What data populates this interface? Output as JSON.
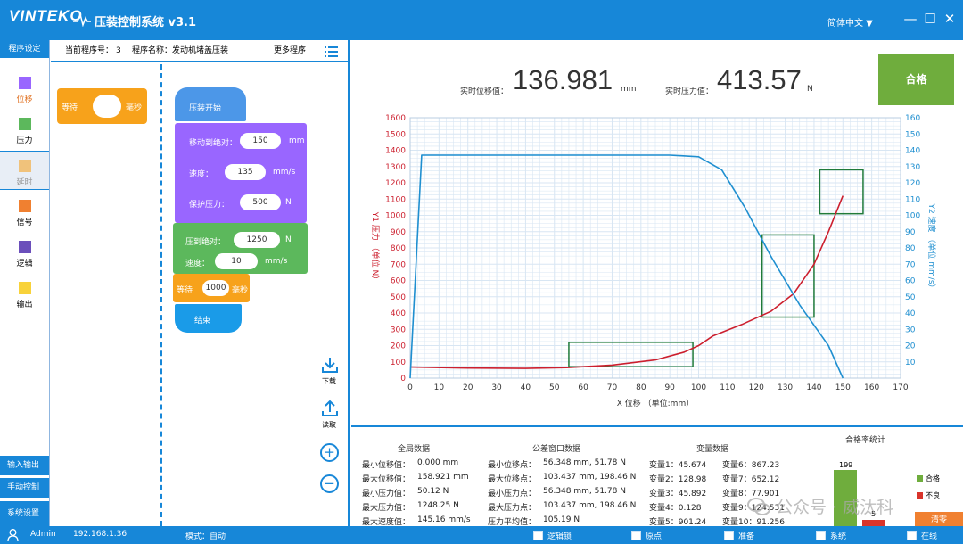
{
  "app": {
    "logo": "VINTEKO",
    "title": "压装控制系统 v3.1",
    "language": "简体中文 ▼",
    "minimize": "—",
    "maximize": "☐",
    "close": "✕"
  },
  "sidebar": {
    "header": "程序设定",
    "categories": [
      {
        "label": "位移",
        "color": "#9966ff"
      },
      {
        "label": "压力",
        "color": "#5cb85c"
      },
      {
        "label": "延时",
        "color": "#f0c27b"
      },
      {
        "label": "信号",
        "color": "#f08030"
      },
      {
        "label": "逻辑",
        "color": "#6b4fbb"
      },
      {
        "label": "输出",
        "color": "#f8d23a"
      }
    ],
    "bottom": [
      "输入输出",
      "手动控制",
      "系统设置"
    ]
  },
  "program": {
    "number_label": "当前程序号：",
    "number": "3",
    "name_label": "程序名称：",
    "name": "发动机堵盖压装",
    "more": "更多程序",
    "palette": {
      "wait_label": "等待",
      "wait_unit": "毫秒"
    },
    "script": {
      "start": "压装开始",
      "move_label": "移动到绝对：",
      "move_value": "150",
      "move_unit": "mm",
      "speed_label": "速度：",
      "speed_value": "135",
      "speed_unit": "mm/s",
      "protect_label": "保护压力：",
      "protect_value": "500",
      "protect_unit": "N",
      "press_label": "压到绝对：",
      "press_value": "1250",
      "press_unit": "N",
      "speed2_label": "速度：",
      "speed2_value": "10",
      "speed2_unit": "mm/s",
      "wait_label": "等待",
      "wait_value": "1000",
      "wait_unit": "毫秒",
      "end": "结束"
    },
    "tools": {
      "download": "下载",
      "read": "读取",
      "zoom_in": "+",
      "zoom_out": "−"
    }
  },
  "realtime": {
    "disp_label": "实时位移值：",
    "disp_value": "136.981",
    "disp_unit": "mm",
    "force_label": "实时压力值：",
    "force_value": "413.57",
    "force_unit": "N",
    "result": "合格"
  },
  "chart_data": {
    "type": "line",
    "title": "",
    "xlabel": "X 位移 （单位:mm）",
    "ylabel": "Y1 压力 （单位 N）",
    "y2label": "Y2 速度 （单位 mm/s）",
    "xlim": [
      0,
      170
    ],
    "ylim": [
      0,
      1600
    ],
    "y2lim": [
      0,
      160
    ],
    "grid": true,
    "xticks": [
      0,
      10,
      20,
      30,
      40,
      50,
      60,
      70,
      80,
      90,
      100,
      110,
      120,
      130,
      140,
      150,
      160,
      170
    ],
    "yticks": [
      0,
      100,
      200,
      300,
      400,
      500,
      600,
      700,
      800,
      900,
      1000,
      1100,
      1200,
      1300,
      1400,
      1500,
      1600
    ],
    "y2ticks": [
      10,
      20,
      30,
      40,
      50,
      60,
      70,
      80,
      90,
      100,
      110,
      120,
      130,
      140,
      150,
      160
    ],
    "series": [
      {
        "axis": "y1",
        "color": "#cc1f2e",
        "x": [
          0,
          20,
          40,
          55,
          70,
          85,
          95,
          100,
          105,
          115,
          125,
          133,
          140,
          145,
          150
        ],
        "y": [
          68,
          62,
          60,
          65,
          80,
          112,
          160,
          200,
          260,
          330,
          410,
          520,
          700,
          900,
          1120
        ]
      },
      {
        "axis": "y2",
        "color": "#1f8fd0",
        "x": [
          0,
          4,
          8,
          50,
          90,
          100,
          108,
          116,
          125,
          135,
          145,
          150
        ],
        "y": [
          0,
          137,
          137,
          137,
          137,
          136,
          128,
          105,
          75,
          45,
          20,
          0
        ]
      }
    ],
    "windows": [
      {
        "x": [
          55,
          98
        ],
        "y": [
          70,
          220
        ]
      },
      {
        "x": [
          122,
          140
        ],
        "y": [
          375,
          880
        ]
      },
      {
        "x": [
          142,
          157
        ],
        "y": [
          1010,
          1280
        ]
      }
    ]
  },
  "stats": {
    "global_title": "全局数据",
    "global": [
      {
        "label": "最小位移值：",
        "value": "0.000 mm"
      },
      {
        "label": "最大位移值：",
        "value": "158.921 mm"
      },
      {
        "label": "最小压力值：",
        "value": "50.12 N"
      },
      {
        "label": "最大压力值：",
        "value": "1248.25 N"
      },
      {
        "label": "最大速度值：",
        "value": "145.16 mm/s"
      }
    ],
    "window_title": "公差窗口数据",
    "window": [
      {
        "label": "最小位移点：",
        "value": "56.348 mm, 51.78 N"
      },
      {
        "label": "最大位移点：",
        "value": "103.437 mm, 198.46 N"
      },
      {
        "label": "最小压力点：",
        "value": "56.348 mm, 51.78 N"
      },
      {
        "label": "最大压力点：",
        "value": "103.437 mm, 198.46 N"
      },
      {
        "label": "压力平均值：",
        "value": "105.19 N"
      }
    ],
    "vars_title": "变量数据",
    "vars_left": [
      "变量1：45.674",
      "变量2：128.98",
      "变量3：45.892",
      "变量4：0.128",
      "变量5：901.24"
    ],
    "vars_right": [
      "变量6：867.23",
      "变量7：652.12",
      "变量8：77.901",
      "变量9：124.531",
      "变量10：91.256"
    ],
    "yield_title": "合格率统计",
    "pass_count": "199",
    "fail_count": "5",
    "legend_pass": "合格",
    "legend_fail": "不良",
    "clear": "清零",
    "pass_color": "#6fad3d",
    "fail_color": "#d9342b"
  },
  "status": {
    "user": "Admin",
    "ip": "192.168.1.36",
    "mode": "模式：自动",
    "flags": [
      "逻辑锁",
      "原点",
      "准备",
      "系统",
      "在线"
    ]
  },
  "watermark": {
    "wx": "公众号",
    "name": "威汰科"
  }
}
